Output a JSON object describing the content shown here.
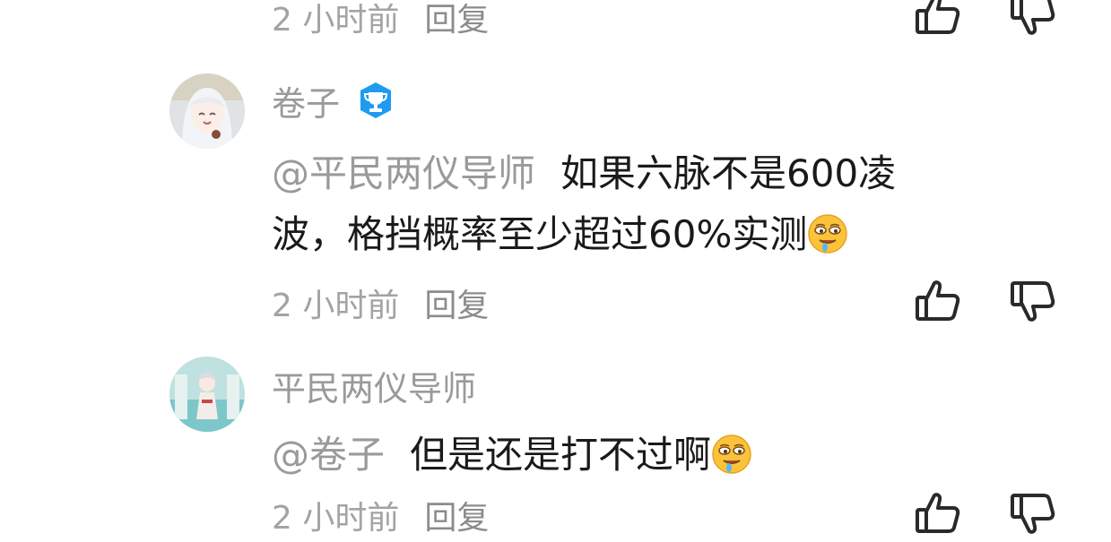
{
  "comments": [
    {
      "timestamp": "2 小时前",
      "reply_label": "回复"
    },
    {
      "username": "卷子",
      "mention": "@平民两仪导师",
      "text_line1": "如果六脉不是600凌",
      "text_line2": "波，格挡概率至少超过60%实测",
      "timestamp": "2 小时前",
      "reply_label": "回复"
    },
    {
      "username": "平民两仪导师",
      "mention": "@卷子",
      "text": "但是还是打不过啊",
      "timestamp": "2 小时前",
      "reply_label": "回复"
    }
  ],
  "icons": {
    "like": "thumbs-up-icon",
    "dislike": "thumbs-down-icon",
    "badge": "trophy-badge-icon",
    "emoji": "drooling-face-emoji"
  },
  "colors": {
    "meta_text": "#a3a3a3",
    "username_text": "#9a9a9a",
    "body_text": "#1a1a1a",
    "badge_blue": "#1e9bf0"
  }
}
